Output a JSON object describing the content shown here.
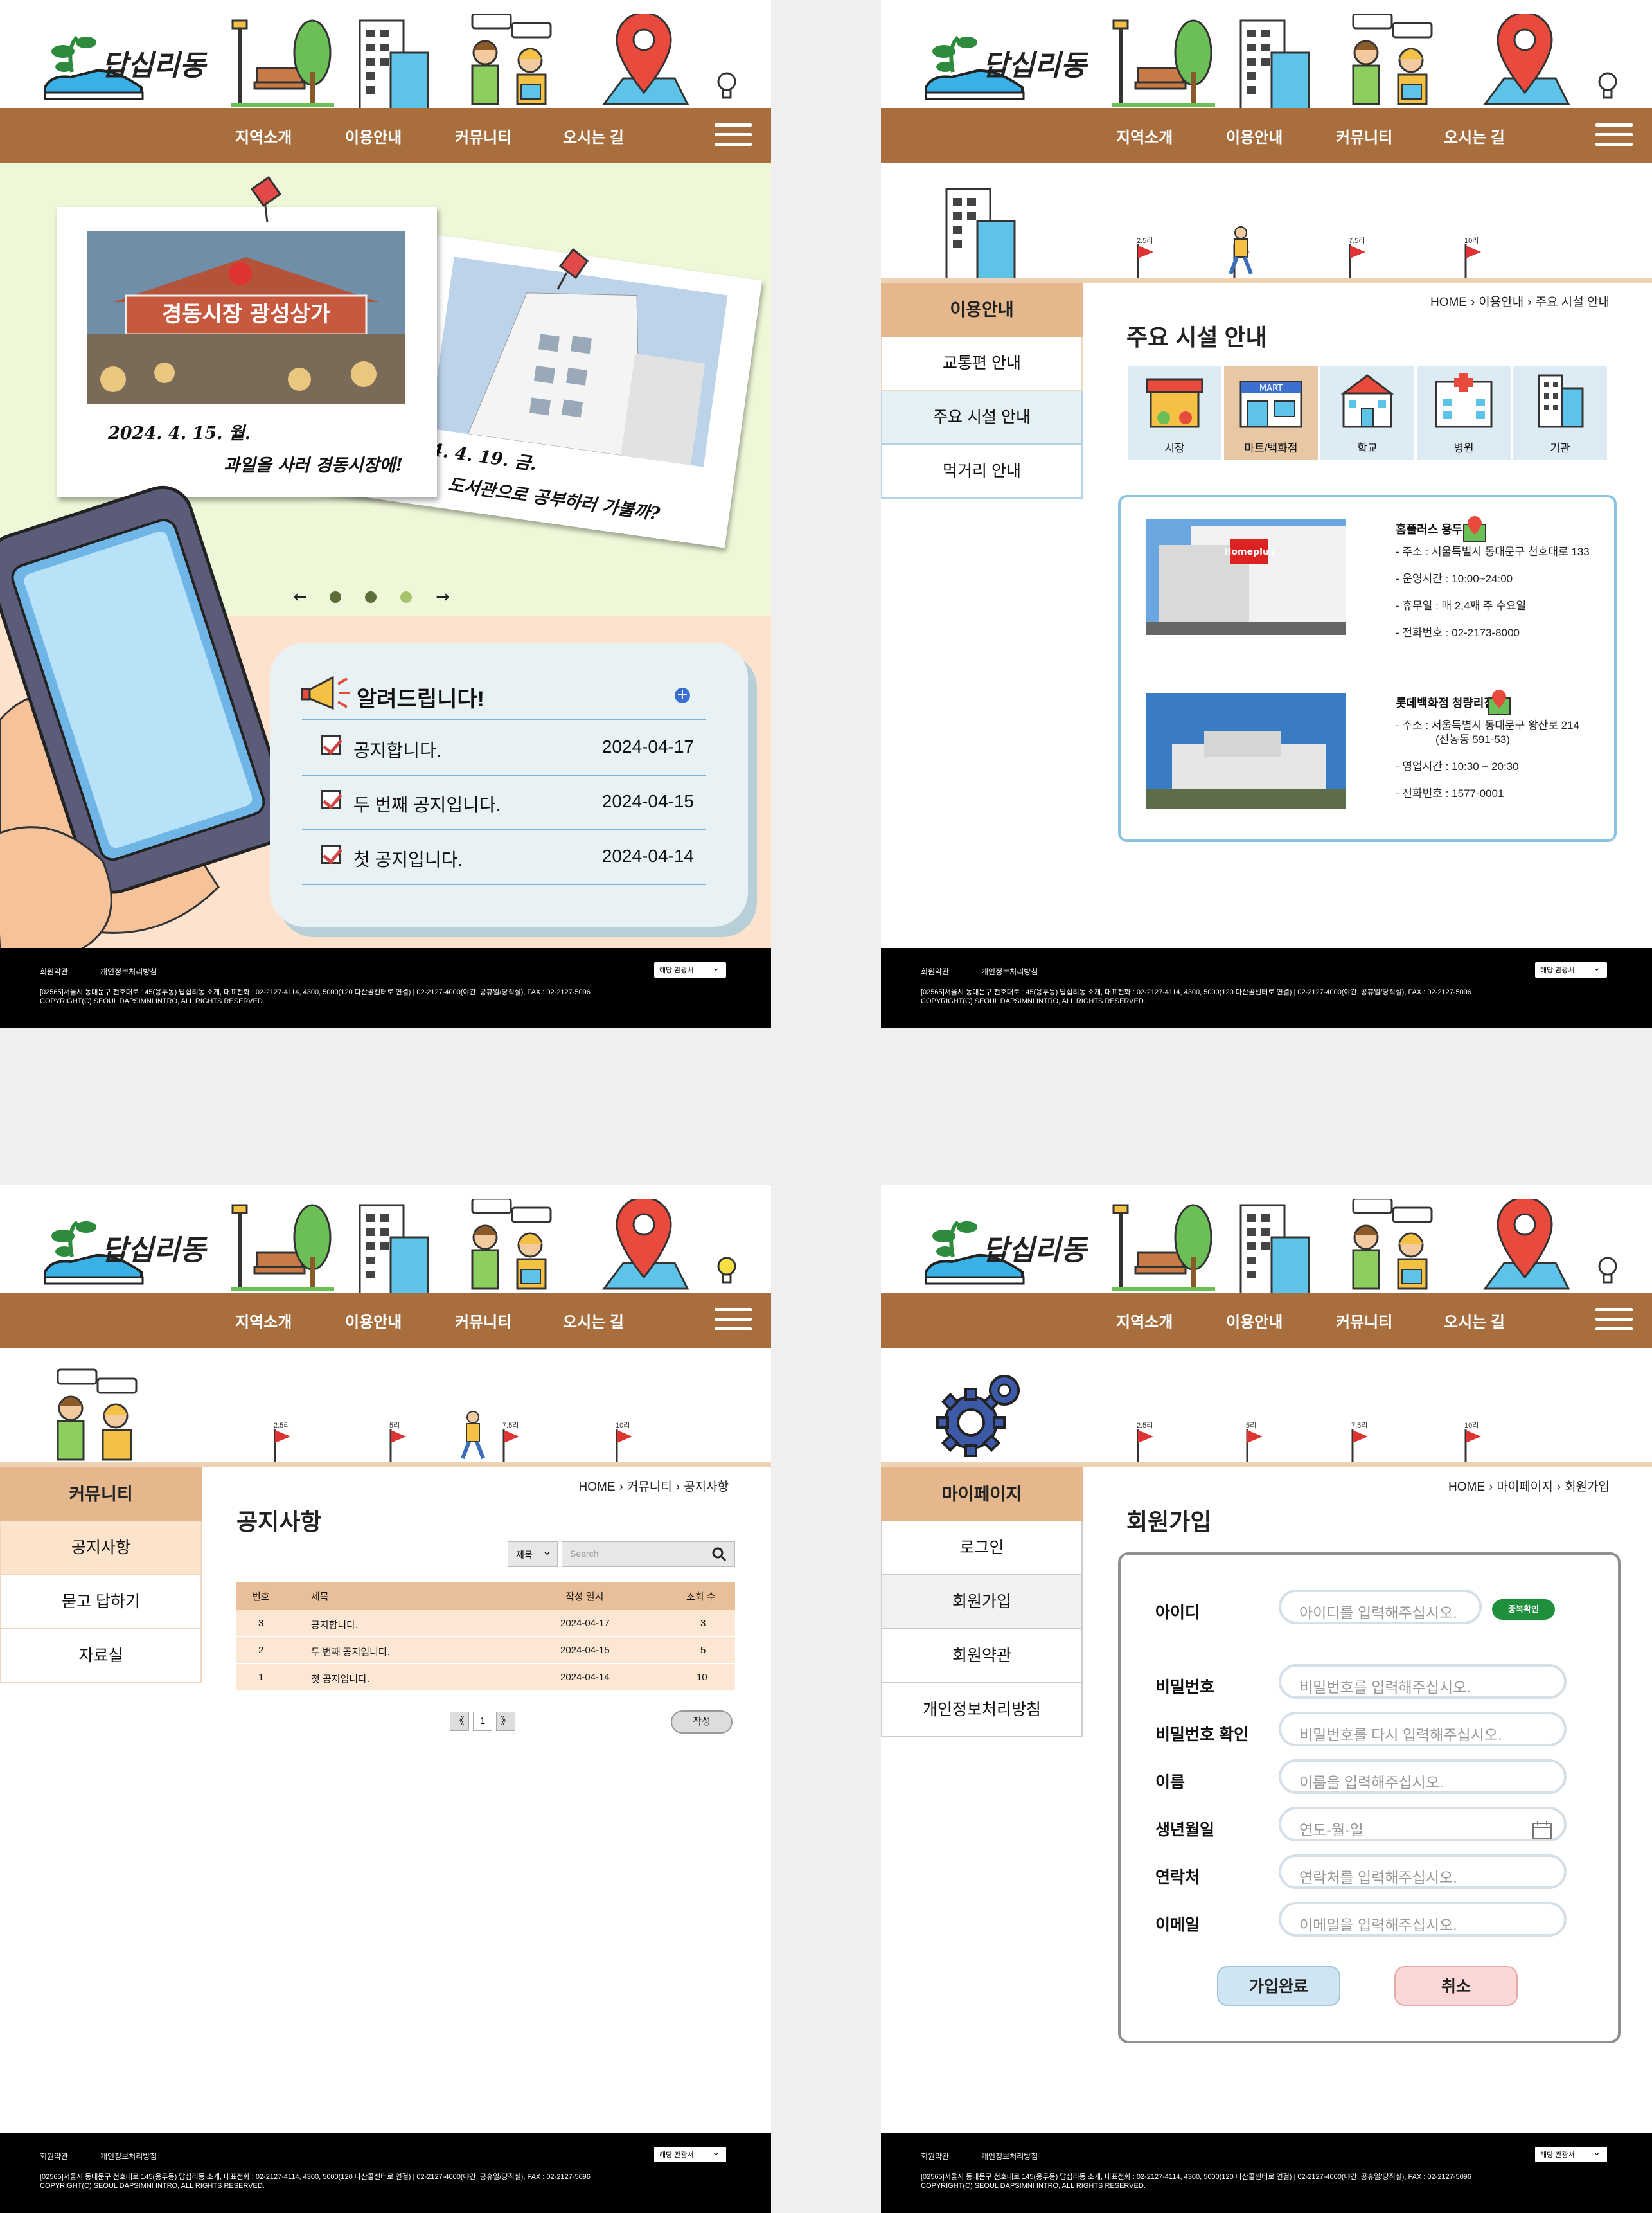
{
  "site": {
    "logo_text": "답십리동",
    "nav": [
      "지역소개",
      "이용안내",
      "커뮤니티",
      "오시는 길"
    ]
  },
  "footer": {
    "links": [
      "회원약관",
      "개인정보처리방침"
    ],
    "select_label": "해당 관광서",
    "address": "[02565]서울시 동대문구 천호대로 145(용두동) 답십리동 소개, 대표전화 : 02-2127-4114, 4300, 5000(120 다산콜센터로 연결) | 02-2127-4000(야간, 공휴일/당직실), FAX : 02-2127-5096",
    "copyright": "COPYRIGHT(C) SEOUL DAPSIMNI INTRO, ALL RIGHTS RESERVED."
  },
  "home": {
    "photo1_caption_line1": "2024. 4. 15. 월.",
    "photo1_caption_line2": "과일을 사러 경동시장에!",
    "photo2_caption_line1": "2024. 4. 19. 금.",
    "photo2_caption_line2": "도서관으로 공부하러 가볼까?",
    "sign_text": "경동시장 광성상가",
    "slider_prev": "←",
    "slider_next": "→",
    "slider_active_index": 2,
    "notice_title": "알려드립니다!",
    "notices": [
      {
        "title": "공지합니다.",
        "date": "2024-04-17"
      },
      {
        "title": "두 번째 공지입니다.",
        "date": "2024-04-15"
      },
      {
        "title": "첫 공지입니다.",
        "date": "2024-04-14"
      }
    ]
  },
  "milestones": [
    "2.5리",
    "5리",
    "7.5리",
    "10리"
  ],
  "facilities": {
    "side_header": "이용안내",
    "side_items": [
      "교통편 안내",
      "주요 시설 안내",
      "먹거리 안내"
    ],
    "crumb": [
      "HOME",
      "이용안내",
      "주요 시설 안내"
    ],
    "title": "주요 시설 안내",
    "tabs": [
      "시장",
      "마트/백화점",
      "학교",
      "병원",
      "기관"
    ],
    "mart_sign": "MART",
    "active_tab": "마트/백화점",
    "items": [
      {
        "name": "홈플러스 용두점",
        "img_text": "Homeplus",
        "lines": [
          "- 주소 : 서울특별시 동대문구 천호대로 133",
          "- 운영시간 : 10:00~24:00",
          "- 휴무일 : 매 2,4째 주 수요일",
          "- 전화번호 : 02-2173-8000"
        ]
      },
      {
        "name": "롯데백화점 청량리점",
        "lines": [
          "- 주소 : 서울특별시 동대문구 왕산로 214",
          "(전농동 591-53)",
          "- 영업시간 : 10:30 ~ 20:30",
          "- 전화번호 : 1577-0001"
        ]
      }
    ]
  },
  "notice_board": {
    "side_header": "커뮤니티",
    "side_items": [
      "공지사항",
      "묻고 답하기",
      "자료실"
    ],
    "crumb": [
      "HOME",
      "커뮤니티",
      "공지사항"
    ],
    "title": "공지사항",
    "select_value": "제목",
    "search_placeholder": "Search",
    "columns": [
      "번호",
      "제목",
      "작성 일시",
      "조회 수"
    ],
    "rows": [
      [
        "3",
        "공지합니다.",
        "2024-04-17",
        "3"
      ],
      [
        "2",
        "두 번째 공지입니다.",
        "2024-04-15",
        "5"
      ],
      [
        "1",
        "첫 공지입니다.",
        "2024-04-14",
        "10"
      ]
    ],
    "pager": [
      "《",
      "1",
      "》"
    ],
    "write_label": "작성"
  },
  "signup": {
    "side_header": "마이페이지",
    "side_items": [
      "로그인",
      "회원가입",
      "회원약관",
      "개인정보처리방침"
    ],
    "crumb": [
      "HOME",
      "마이페이지",
      "회원가입"
    ],
    "title": "회원가입",
    "fields": [
      {
        "label": "아이디",
        "placeholder": "아이디를 입력해주십시오."
      },
      {
        "label": "비밀번호",
        "placeholder": "비밀번호를 입력해주십시오."
      },
      {
        "label": "비밀번호 확인",
        "placeholder": "비밀번호를 다시 입력해주십시오."
      },
      {
        "label": "이름",
        "placeholder": "이름을 입력해주십시오."
      },
      {
        "label": "생년월일",
        "placeholder": "연도-월-일"
      },
      {
        "label": "연락처",
        "placeholder": "연락처를 입력해주십시오."
      },
      {
        "label": "이메일",
        "placeholder": "이메일을 입력해주십시오."
      }
    ],
    "dup_check": "중복확인",
    "submit": "가입완료",
    "cancel": "취소"
  },
  "colors": {
    "nav_brown": "#a86e3e",
    "side_header_tan": "#e4b78c",
    "hero_green": "#eef8d8",
    "hero_peach": "#fde3ce",
    "footer_black": "#000000",
    "notice_blue": "#e8f2f4"
  }
}
